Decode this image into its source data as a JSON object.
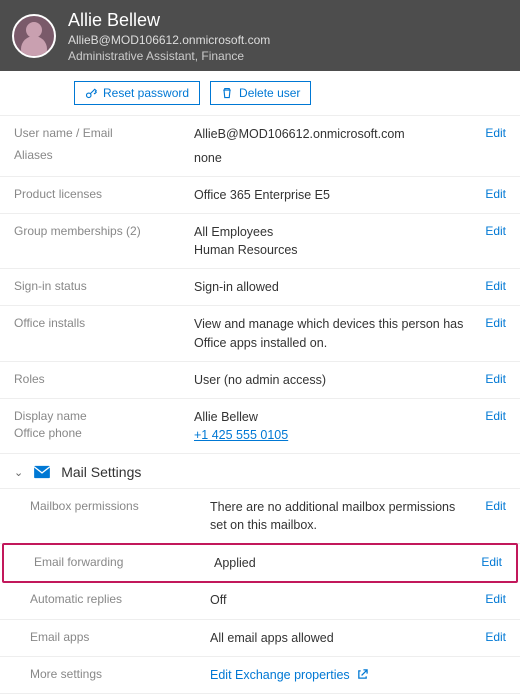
{
  "header": {
    "name": "Allie Bellew",
    "email": "AllieB@MOD106612.onmicrosoft.com",
    "role": "Administrative Assistant, Finance"
  },
  "toolbar": {
    "reset_password": "Reset password",
    "delete_user": "Delete user"
  },
  "edit_label": "Edit",
  "rows": {
    "username_label": "User name / Email",
    "username_value": "AllieB@MOD106612.onmicrosoft.com",
    "aliases_label": "Aliases",
    "aliases_value": "none",
    "licenses_label": "Product licenses",
    "licenses_value": "Office 365 Enterprise E5",
    "groups_label": "Group memberships (2)",
    "groups_value_1": "All Employees",
    "groups_value_2": "Human Resources",
    "signin_label": "Sign-in status",
    "signin_value": "Sign-in allowed",
    "installs_label": "Office installs",
    "installs_value": "View and manage which devices this person has Office apps installed on.",
    "roles_label": "Roles",
    "roles_value": "User (no admin access)",
    "display_label_1": "Display name",
    "display_label_2": "Office phone",
    "display_value_1": "Allie Bellew",
    "display_value_2": "+1 425 555 0105"
  },
  "mail_section": {
    "title": "Mail Settings",
    "perm_label": "Mailbox permissions",
    "perm_value": "There are no additional mailbox permissions set on this mailbox.",
    "fwd_label": "Email forwarding",
    "fwd_value": "Applied",
    "auto_label": "Automatic replies",
    "auto_value": "Off",
    "apps_label": "Email apps",
    "apps_value": "All email apps allowed",
    "more_label": "More settings",
    "more_value": "Edit Exchange properties"
  }
}
